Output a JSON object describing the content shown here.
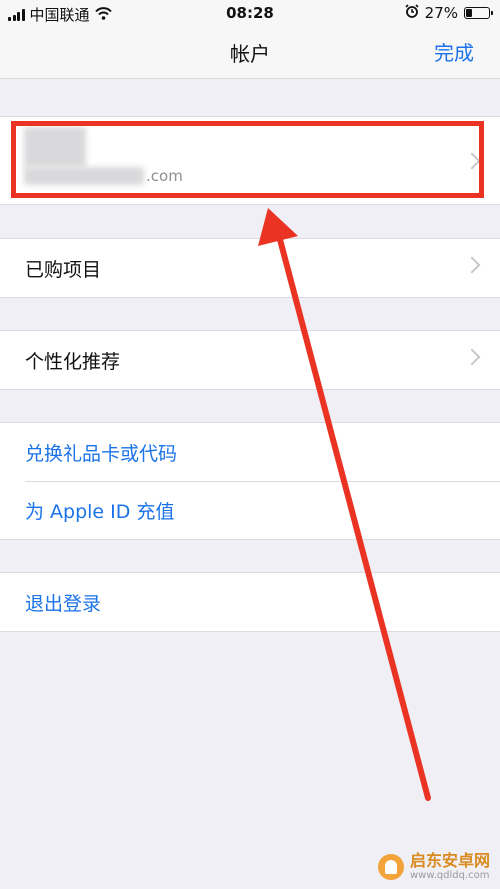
{
  "status_bar": {
    "carrier": "中国联通",
    "time": "08:28",
    "battery": "27%",
    "battery_level": 0.27
  },
  "nav": {
    "title": "帐户",
    "done_label": "完成"
  },
  "account": {
    "email_suffix": ".com"
  },
  "menu": {
    "purchased": "已购项目",
    "personalization": "个性化推荐",
    "redeem": "兑换礼品卡或代码",
    "add_funds": "为 Apple ID 充值",
    "sign_out": "退出登录"
  },
  "watermark": {
    "name": "启东安卓网",
    "url": "www.qdldq.com"
  },
  "colors": {
    "accent": "#1a73e8",
    "annotation": "#ea3323",
    "background": "#f0eff5"
  }
}
